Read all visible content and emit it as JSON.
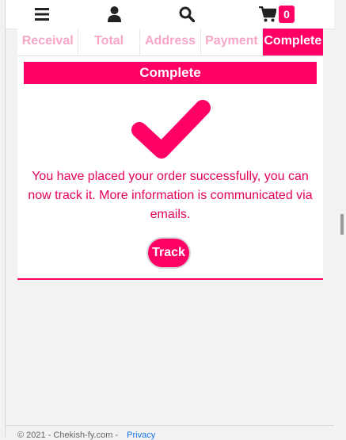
{
  "header": {
    "menu_icon": "bars-icon",
    "user_icon": "user-icon",
    "search_icon": "search-icon",
    "cart_icon": "cart-icon",
    "cart_count": "0"
  },
  "steps": [
    {
      "label": "Receival",
      "active": false
    },
    {
      "label": "Total",
      "active": false
    },
    {
      "label": "Address",
      "active": false
    },
    {
      "label": "Payment",
      "active": false
    },
    {
      "label": "Complete",
      "active": true
    }
  ],
  "main": {
    "title": "Complete",
    "message": "You have placed your order successfully, you can now track it. More information is communicated via emails.",
    "track_label": "Track"
  },
  "footer": {
    "copyright": "© 2021 - Chekish-fy.com -",
    "privacy_label": "Privacy"
  },
  "colors": {
    "accent": "#ff0066",
    "text_accent": "#e6005c",
    "inactive_step": "#f7a6c7",
    "icon": "#222222"
  }
}
